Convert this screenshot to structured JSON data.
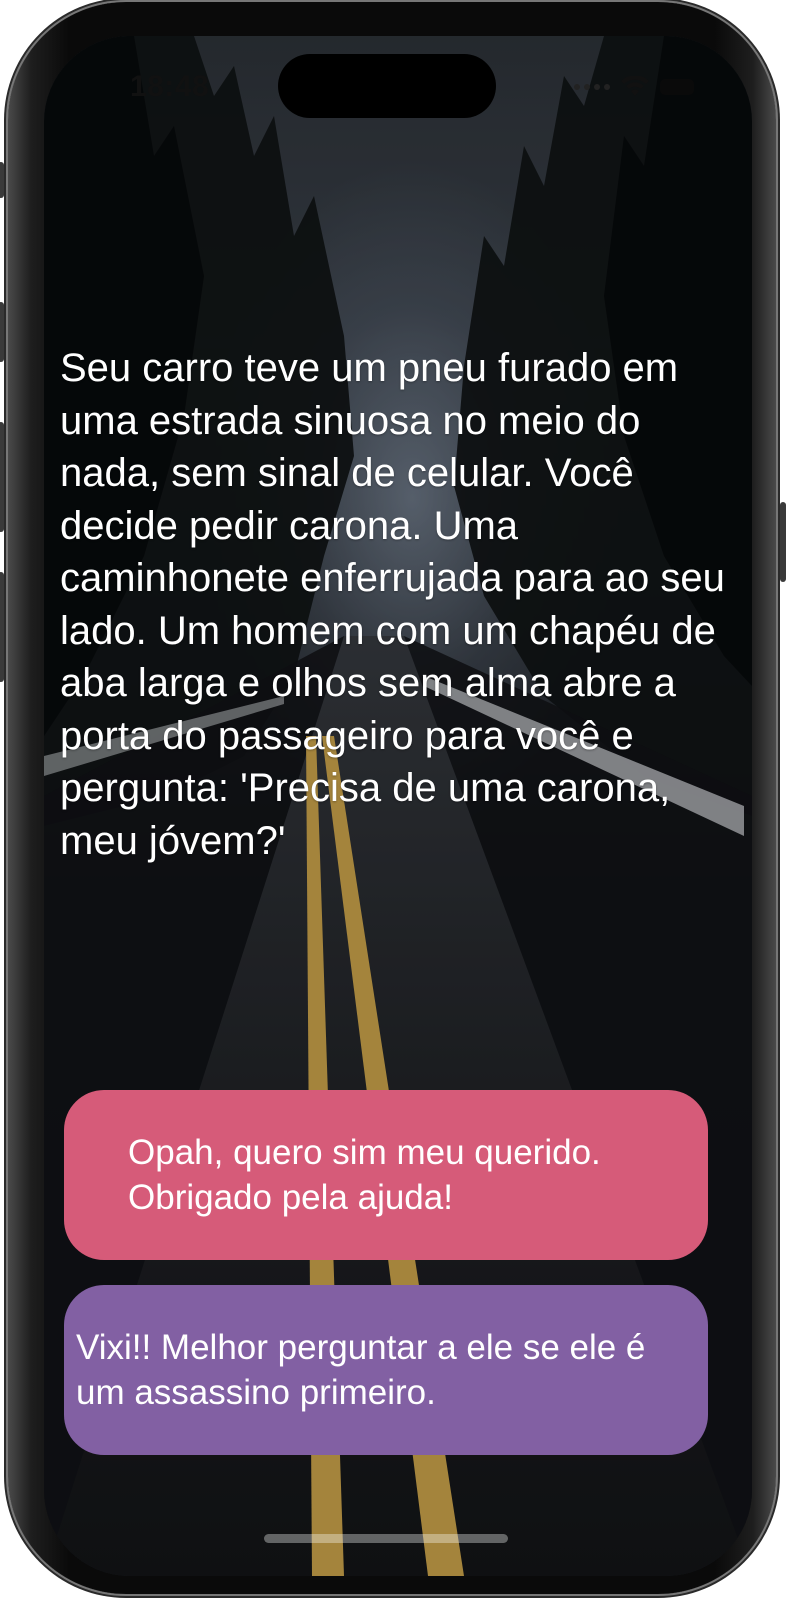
{
  "status_bar": {
    "time": "18:48",
    "wifi_icon": "wifi-icon",
    "battery_icon": "battery-icon"
  },
  "background": {
    "description_icon": "forest-road-image"
  },
  "story": {
    "text": "Seu carro teve um pneu furado em uma estrada sinuosa no meio do nada, sem sinal de celular. Você decide pedir carona. Uma caminhonete enferrujada para ao seu lado. Um homem com um chapéu de aba larga e olhos sem alma abre a porta do passageiro para você e pergunta: 'Precisa de uma carona, meu jóvem?'"
  },
  "choices": [
    {
      "label": "Opah, quero sim meu querido. Obrigado pela ajuda!",
      "color": "#d65b79"
    },
    {
      "label": "Vixi!! Melhor perguntar a ele se ele é um assassino primeiro.",
      "color": "#8260a3"
    }
  ],
  "colors": {
    "choice_a": "#d65b79",
    "choice_b": "#8260a3",
    "text": "#ffffff"
  }
}
